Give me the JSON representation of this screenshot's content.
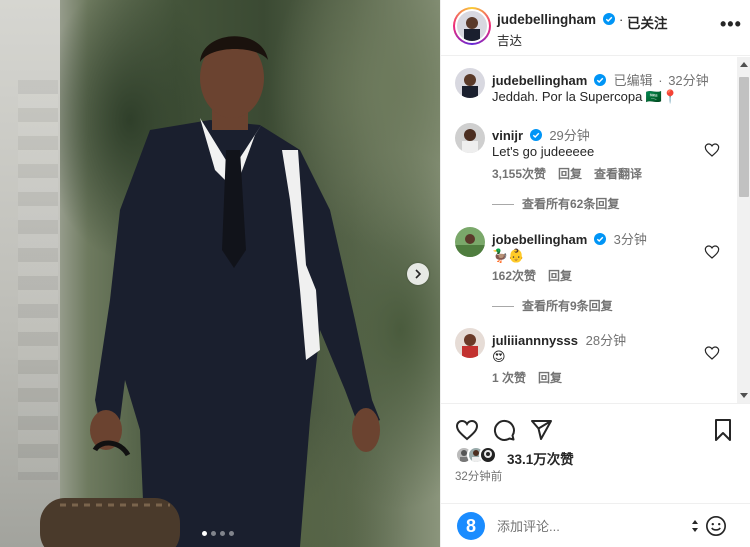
{
  "post": {
    "author": "judebellingham",
    "follow_separator": "·",
    "follow_state": "已关注",
    "location": "吉达",
    "more": "•••",
    "photo_alt": "Player in dark suit carrying a bag",
    "carousel": {
      "current": 1,
      "total": 4
    }
  },
  "caption": {
    "username": "judebellingham",
    "edited": "已编辑",
    "sep": "·",
    "time": "32分钟",
    "text": "Jeddah. Por la Supercopa 🇸🇦📍"
  },
  "comments": [
    {
      "username": "vinijr",
      "time": "29分钟",
      "text": "Let's go judeeeee",
      "likes": "3,155次赞",
      "reply": "回复",
      "translate": "查看翻译",
      "view_replies": "查看所有62条回复"
    },
    {
      "username": "jobebellingham",
      "time": "3分钟",
      "text": "🦆👶",
      "likes": "162次赞",
      "reply": "回复",
      "view_replies": "查看所有9条回复"
    },
    {
      "username": "juliiiannnysss",
      "time": "28分钟",
      "text": "😍",
      "likes": "1 次赞",
      "reply": "回复"
    }
  ],
  "engagement": {
    "likes": "33.1万次赞",
    "time_ago": "32分钟前"
  },
  "add_comment": {
    "logo": "8",
    "placeholder": "添加评论..."
  },
  "icons": {
    "like": "heart-icon",
    "comment": "comment-icon",
    "share": "send-icon",
    "save": "bookmark-icon",
    "more": "more-icon",
    "emoji": "emoji-icon"
  },
  "colors": {
    "text": "#262626",
    "muted": "#737373",
    "verified": "#0095f6",
    "border": "#efefef",
    "brand_logo": "#1a8cff"
  }
}
